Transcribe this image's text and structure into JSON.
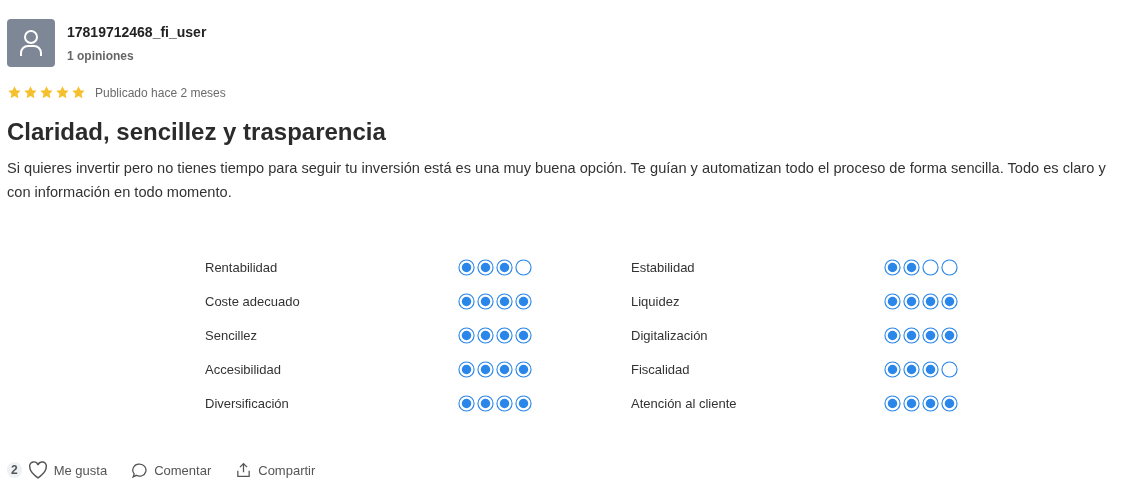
{
  "user": {
    "name": "17819712468_fi_user",
    "reviews": "1 opiniones"
  },
  "review": {
    "stars": 5,
    "posted": "Publicado hace 2 meses",
    "title": "Claridad, sencillez y trasparencia",
    "body": "Si quieres invertir pero no tienes tiempo para seguir tu inversión está es una muy buena opción. Te guían y automatizan todo el proceso de forma sencilla. Todo es claro y con información en todo momento."
  },
  "ratings": [
    {
      "label": "Rentabilidad",
      "stars": 3
    },
    {
      "label": "Estabilidad",
      "stars": 2
    },
    {
      "label": "Coste adecuado",
      "stars": 4
    },
    {
      "label": "Liquidez",
      "stars": 4
    },
    {
      "label": "Sencillez",
      "stars": 4
    },
    {
      "label": "Digitalización",
      "stars": 4
    },
    {
      "label": "Accesibilidad",
      "stars": 4
    },
    {
      "label": "Fiscalidad",
      "stars": 3
    },
    {
      "label": "Diversificación",
      "stars": 4
    },
    {
      "label": "Atención al cliente",
      "stars": 4
    }
  ],
  "actions": {
    "like_count": "2",
    "like": "Me gusta",
    "comment": "Comentar",
    "share": "Compartir"
  }
}
